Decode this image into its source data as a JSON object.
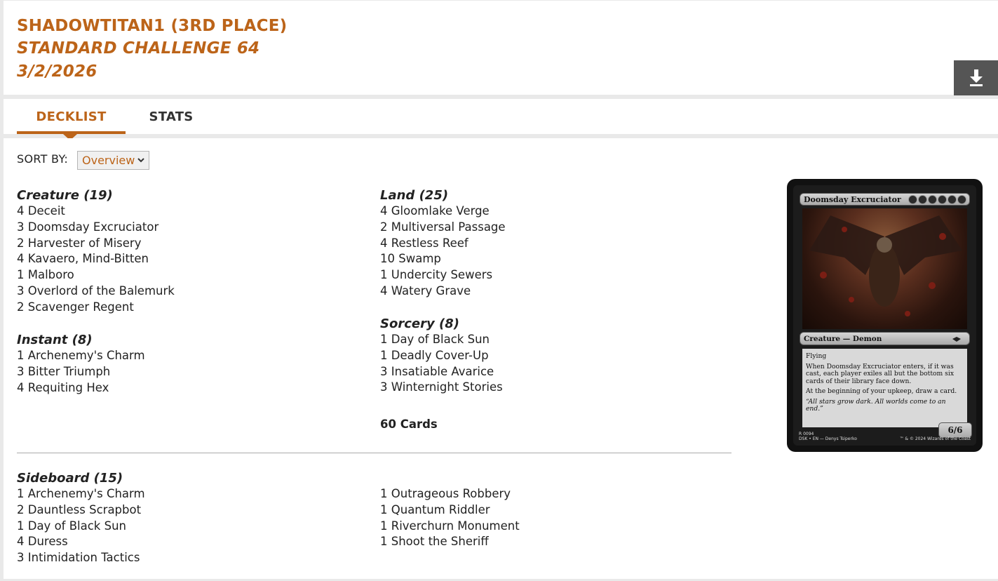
{
  "header": {
    "player": "SHADOWTITAN1 (3RD PLACE)",
    "event": "STANDARD CHALLENGE 64",
    "date": "3/2/2026",
    "download_icon": "download-icon"
  },
  "tabs": [
    {
      "label": "DECKLIST",
      "active": true
    },
    {
      "label": "STATS",
      "active": false
    }
  ],
  "sort": {
    "label": "SORT BY:",
    "selected": "Overview"
  },
  "maindeck": {
    "creature": {
      "heading": "Creature (19)",
      "cards": [
        "4 Deceit",
        "3 Doomsday Excruciator",
        "2 Harvester of Misery",
        "4 Kavaero, Mind-Bitten",
        "1 Malboro",
        "3 Overlord of the Balemurk",
        "2 Scavenger Regent"
      ]
    },
    "instant": {
      "heading": "Instant (8)",
      "cards": [
        "1 Archenemy's Charm",
        "3 Bitter Triumph",
        "4 Requiting Hex"
      ]
    },
    "land": {
      "heading": "Land (25)",
      "cards": [
        "4 Gloomlake Verge",
        "2 Multiversal Passage",
        "4 Restless Reef",
        "10 Swamp",
        "1 Undercity Sewers",
        "4 Watery Grave"
      ]
    },
    "sorcery": {
      "heading": "Sorcery (8)",
      "cards": [
        "1 Day of Black Sun",
        "1 Deadly Cover-Up",
        "3 Insatiable Avarice",
        "3 Winternight Stories"
      ]
    },
    "total": "60 Cards"
  },
  "sideboard": {
    "heading": "Sideboard (15)",
    "col1": [
      "1 Archenemy's Charm",
      "2 Dauntless Scrapbot",
      "1 Day of Black Sun",
      "4 Duress",
      "3 Intimidation Tactics"
    ],
    "col2": [
      "1 Outrageous Robbery",
      "1 Quantum Riddler",
      "1 Riverchurn Monument",
      "1 Shoot the Sheriff"
    ]
  },
  "card_preview": {
    "name": "Doomsday Excruciator",
    "type_line": "Creature — Demon",
    "rules": [
      "Flying",
      "When Doomsday Excruciator enters, if it was cast, each player exiles all but the bottom six cards of their library face down.",
      "At the beginning of your upkeep, draw a card."
    ],
    "flavor": "“All stars grow dark. All worlds come to an end.”",
    "pt": "6/6",
    "collector_line1": "R 0094",
    "collector_line2": "DSK • EN — Denys Tsiperko",
    "copyright": "™ & © 2024 Wizards of the Coast"
  }
}
